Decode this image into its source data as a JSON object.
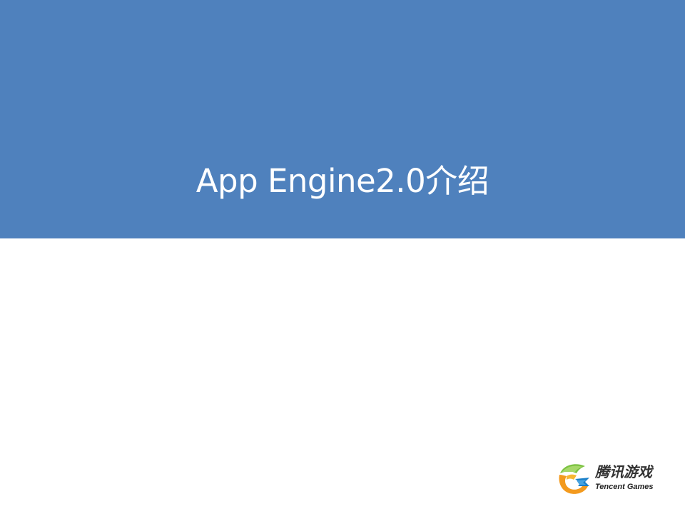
{
  "slide": {
    "title": "App Engine2.0介绍",
    "banner_color": "#4f81bd",
    "background_color": "#ffffff"
  },
  "logo": {
    "icon": "tencent-games-logo-icon",
    "name_cn": "腾讯游戏",
    "name_en": "Tencent Games"
  }
}
